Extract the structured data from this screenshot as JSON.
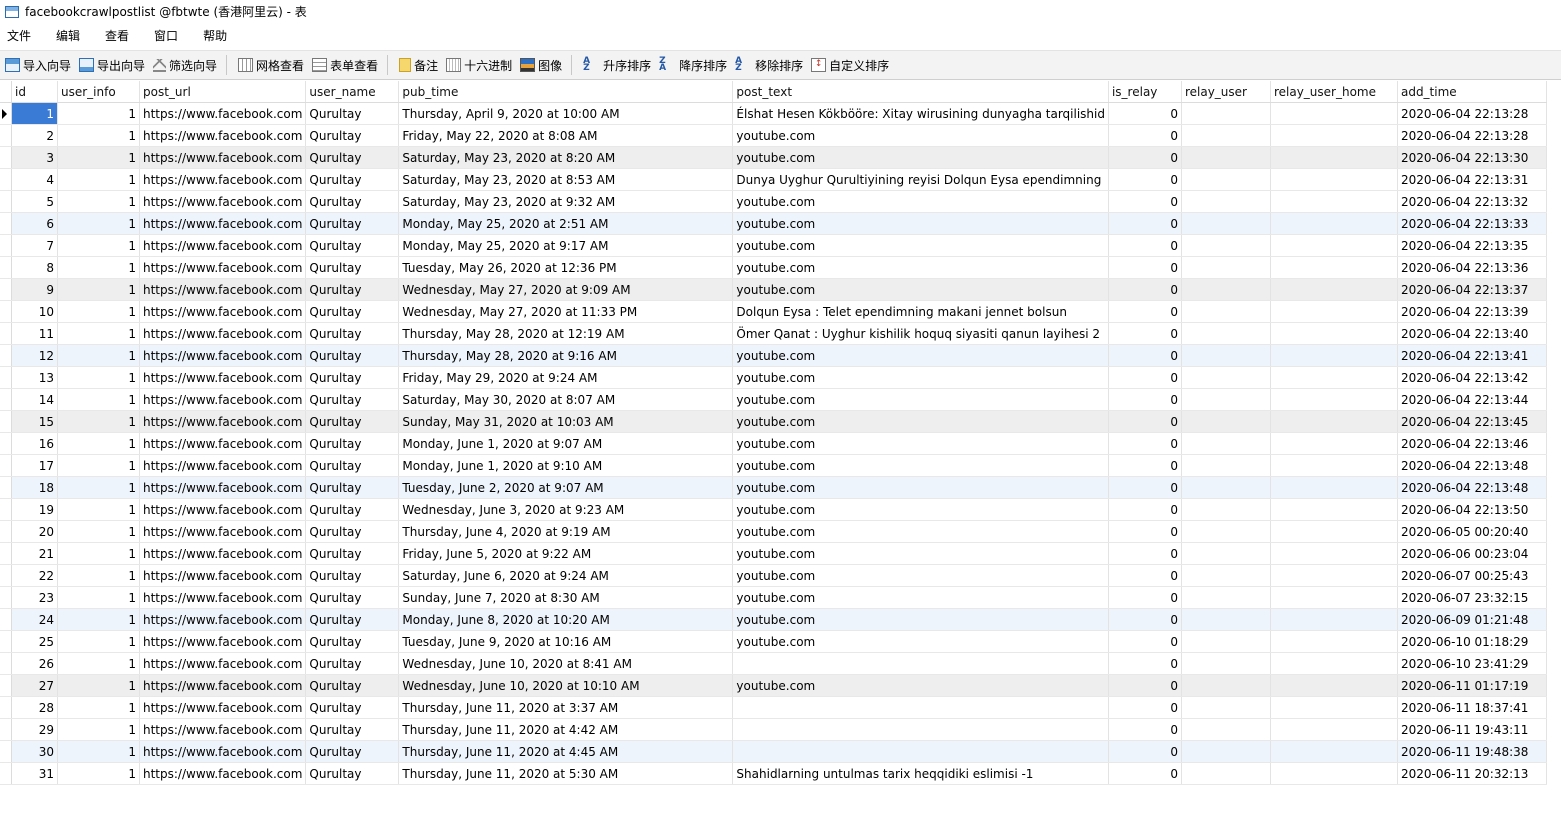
{
  "window": {
    "title": "facebookcrawlpostlist @fbtwte (香港阿里云) - 表",
    "app_icon": "table-icon"
  },
  "menu": [
    "文件",
    "编辑",
    "查看",
    "窗口",
    "帮助"
  ],
  "toolbar": {
    "import_wizard": "导入向导",
    "export_wizard": "导出向导",
    "filter_wizard": "筛选向导",
    "grid_view": "网格查看",
    "form_view": "表单查看",
    "memo": "备注",
    "hex": "十六进制",
    "image": "图像",
    "sort_asc": "升序排序",
    "sort_desc": "降序排序",
    "remove_sort": "移除排序",
    "custom_sort": "自定义排序"
  },
  "table": {
    "columns": [
      "id",
      "user_info",
      "post_url",
      "user_name",
      "pub_time",
      "post_text",
      "is_relay",
      "relay_user",
      "relay_user_home",
      "add_time"
    ],
    "rows": [
      [
        "1",
        "1",
        "https://www.facebook.com",
        "Qurultay",
        "Thursday, April 9, 2020 at 10:00 AM",
        "Élshat Hesen Kökbööre: Xitay wirusining dunyagha tarqilishid",
        "0",
        "",
        "",
        "2020-06-04 22:13:28"
      ],
      [
        "2",
        "1",
        "https://www.facebook.com",
        "Qurultay",
        "Friday, May 22, 2020 at 8:08 AM",
        "youtube.com",
        "0",
        "",
        "",
        "2020-06-04 22:13:28"
      ],
      [
        "3",
        "1",
        "https://www.facebook.com",
        "Qurultay",
        "Saturday, May 23, 2020 at 8:20 AM",
        "youtube.com",
        "0",
        "",
        "",
        "2020-06-04 22:13:30"
      ],
      [
        "4",
        "1",
        "https://www.facebook.com",
        "Qurultay",
        "Saturday, May 23, 2020 at 8:53 AM",
        "Dunya Uyghur Qurultiyining reyisi Dolqun Eysa ependimning",
        "0",
        "",
        "",
        "2020-06-04 22:13:31"
      ],
      [
        "5",
        "1",
        "https://www.facebook.com",
        "Qurultay",
        "Saturday, May 23, 2020 at 9:32 AM",
        "youtube.com",
        "0",
        "",
        "",
        "2020-06-04 22:13:32"
      ],
      [
        "6",
        "1",
        "https://www.facebook.com",
        "Qurultay",
        "Monday, May 25, 2020 at 2:51 AM",
        "youtube.com",
        "0",
        "",
        "",
        "2020-06-04 22:13:33"
      ],
      [
        "7",
        "1",
        "https://www.facebook.com",
        "Qurultay",
        "Monday, May 25, 2020 at 9:17 AM",
        "youtube.com",
        "0",
        "",
        "",
        "2020-06-04 22:13:35"
      ],
      [
        "8",
        "1",
        "https://www.facebook.com",
        "Qurultay",
        "Tuesday, May 26, 2020 at 12:36 PM",
        "youtube.com",
        "0",
        "",
        "",
        "2020-06-04 22:13:36"
      ],
      [
        "9",
        "1",
        "https://www.facebook.com",
        "Qurultay",
        "Wednesday, May 27, 2020 at 9:09 AM",
        "youtube.com",
        "0",
        "",
        "",
        "2020-06-04 22:13:37"
      ],
      [
        "10",
        "1",
        "https://www.facebook.com",
        "Qurultay",
        "Wednesday, May 27, 2020 at 11:33 PM",
        "Dolqun Eysa : Telet ependimning makani jennet bolsun",
        "0",
        "",
        "",
        "2020-06-04 22:13:39"
      ],
      [
        "11",
        "1",
        "https://www.facebook.com",
        "Qurultay",
        "Thursday, May 28, 2020 at 12:19 AM",
        "Ömer Qanat : Uyghur kishilik hoquq siyasiti qanun layihesi 2",
        "0",
        "",
        "",
        "2020-06-04 22:13:40"
      ],
      [
        "12",
        "1",
        "https://www.facebook.com",
        "Qurultay",
        "Thursday, May 28, 2020 at 9:16 AM",
        "youtube.com",
        "0",
        "",
        "",
        "2020-06-04 22:13:41"
      ],
      [
        "13",
        "1",
        "https://www.facebook.com",
        "Qurultay",
        "Friday, May 29, 2020 at 9:24 AM",
        "youtube.com",
        "0",
        "",
        "",
        "2020-06-04 22:13:42"
      ],
      [
        "14",
        "1",
        "https://www.facebook.com",
        "Qurultay",
        "Saturday, May 30, 2020 at 8:07 AM",
        "youtube.com",
        "0",
        "",
        "",
        "2020-06-04 22:13:44"
      ],
      [
        "15",
        "1",
        "https://www.facebook.com",
        "Qurultay",
        "Sunday, May 31, 2020 at 10:03 AM",
        "youtube.com",
        "0",
        "",
        "",
        "2020-06-04 22:13:45"
      ],
      [
        "16",
        "1",
        "https://www.facebook.com",
        "Qurultay",
        "Monday, June 1, 2020 at 9:07 AM",
        "youtube.com",
        "0",
        "",
        "",
        "2020-06-04 22:13:46"
      ],
      [
        "17",
        "1",
        "https://www.facebook.com",
        "Qurultay",
        "Monday, June 1, 2020 at 9:10 AM",
        "youtube.com",
        "0",
        "",
        "",
        "2020-06-04 22:13:48"
      ],
      [
        "18",
        "1",
        "https://www.facebook.com",
        "Qurultay",
        "Tuesday, June 2, 2020 at 9:07 AM",
        "youtube.com",
        "0",
        "",
        "",
        "2020-06-04 22:13:48"
      ],
      [
        "19",
        "1",
        "https://www.facebook.com",
        "Qurultay",
        "Wednesday, June 3, 2020 at 9:23 AM",
        "youtube.com",
        "0",
        "",
        "",
        "2020-06-04 22:13:50"
      ],
      [
        "20",
        "1",
        "https://www.facebook.com",
        "Qurultay",
        "Thursday, June 4, 2020 at 9:19 AM",
        "youtube.com",
        "0",
        "",
        "",
        "2020-06-05 00:20:40"
      ],
      [
        "21",
        "1",
        "https://www.facebook.com",
        "Qurultay",
        "Friday, June 5, 2020 at 9:22 AM",
        "youtube.com",
        "0",
        "",
        "",
        "2020-06-06 00:23:04"
      ],
      [
        "22",
        "1",
        "https://www.facebook.com",
        "Qurultay",
        "Saturday, June 6, 2020 at 9:24 AM",
        "youtube.com",
        "0",
        "",
        "",
        "2020-06-07 00:25:43"
      ],
      [
        "23",
        "1",
        "https://www.facebook.com",
        "Qurultay",
        "Sunday, June 7, 2020 at 8:30 AM",
        "youtube.com",
        "0",
        "",
        "",
        "2020-06-07 23:32:15"
      ],
      [
        "24",
        "1",
        "https://www.facebook.com",
        "Qurultay",
        "Monday, June 8, 2020 at 10:20 AM",
        "youtube.com",
        "0",
        "",
        "",
        "2020-06-09 01:21:48"
      ],
      [
        "25",
        "1",
        "https://www.facebook.com",
        "Qurultay",
        "Tuesday, June 9, 2020 at 10:16 AM",
        "youtube.com",
        "0",
        "",
        "",
        "2020-06-10 01:18:29"
      ],
      [
        "26",
        "1",
        "https://www.facebook.com",
        "Qurultay",
        "Wednesday, June 10, 2020 at 8:41 AM",
        "",
        "0",
        "",
        "",
        "2020-06-10 23:41:29"
      ],
      [
        "27",
        "1",
        "https://www.facebook.com",
        "Qurultay",
        "Wednesday, June 10, 2020 at 10:10 AM",
        "youtube.com",
        "0",
        "",
        "",
        "2020-06-11 01:17:19"
      ],
      [
        "28",
        "1",
        "https://www.facebook.com",
        "Qurultay",
        "Thursday, June 11, 2020 at 3:37 AM",
        "",
        "0",
        "",
        "",
        "2020-06-11 18:37:41"
      ],
      [
        "29",
        "1",
        "https://www.facebook.com",
        "Qurultay",
        "Thursday, June 11, 2020 at 4:42 AM",
        "",
        "0",
        "",
        "",
        "2020-06-11 19:43:11"
      ],
      [
        "30",
        "1",
        "https://www.facebook.com",
        "Qurultay",
        "Thursday, June 11, 2020 at 4:45 AM",
        "",
        "0",
        "",
        "",
        "2020-06-11 19:48:38"
      ],
      [
        "31",
        "1",
        "https://www.facebook.com",
        "Qurultay",
        "Thursday, June 11, 2020 at 5:30 AM",
        "Shahidlarning untulmas tarix heqqidiki eslimisi -1",
        "0",
        "",
        "",
        "2020-06-11 20:32:13"
      ]
    ],
    "selected_row": 1
  }
}
